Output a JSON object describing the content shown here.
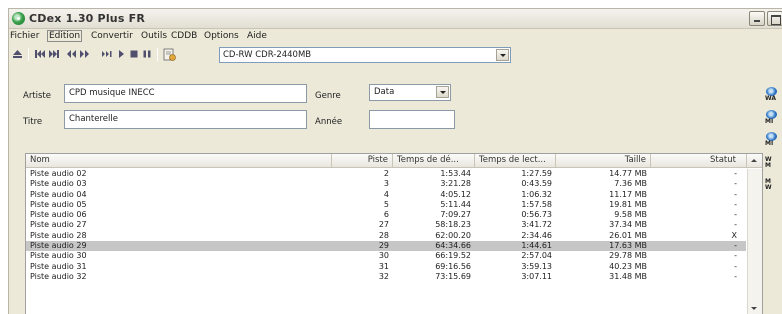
{
  "window": {
    "title": "CDex 1.30 Plus FR"
  },
  "menu": [
    "Fichier",
    "Edition",
    "Convertir",
    "Outils",
    "CDDB",
    "Options",
    "Aide"
  ],
  "toolbar": {
    "icons": [
      "eject-icon",
      "first-track-icon",
      "last-track-icon",
      "rewind-icon",
      "fast-forward-icon",
      "next-track-icon",
      "play-icon",
      "stop-icon",
      "pause-icon",
      "cddb-icon"
    ],
    "drive": "CD-RW  CDR-2440MB"
  },
  "info": {
    "artist_label": "Artiste",
    "artist_value": "CPD musique INECC",
    "title_label": "Titre",
    "title_value": "Chanterelle",
    "genre_label": "Genre",
    "genre_value": "Data",
    "year_label": "Année",
    "year_value": ""
  },
  "table": {
    "columns": [
      "Nom",
      "Piste",
      "Temps de dé...",
      "Temps de lect...",
      "Taille",
      "Statut"
    ],
    "rows": [
      [
        "Piste audio 02",
        "2",
        "1:53.44",
        "1:27.59",
        "14.77 MB",
        "-"
      ],
      [
        "Piste audio 03",
        "3",
        "3:21.28",
        "0:43.59",
        "7.36 MB",
        "-"
      ],
      [
        "Piste audio 04",
        "4",
        "4:05.12",
        "1:06.32",
        "11.17 MB",
        "-"
      ],
      [
        "Piste audio 05",
        "5",
        "5:11.44",
        "1:57.58",
        "19.81 MB",
        "-"
      ],
      [
        "Piste audio 06",
        "6",
        "7:09.27",
        "0:56.73",
        "9.58 MB",
        "-"
      ],
      [
        "Piste audio 27",
        "27",
        "58:18.23",
        "3:41.72",
        "37.34 MB",
        "-"
      ],
      [
        "Piste audio 28",
        "28",
        "62:00.20",
        "2:34.46",
        "26.01 MB",
        "X"
      ],
      [
        "Piste audio 29",
        "29",
        "64:34.66",
        "1:44.61",
        "17.63 MB",
        "-"
      ],
      [
        "Piste audio 30",
        "30",
        "66:19.52",
        "2:57.04",
        "29.78 MB",
        "-"
      ],
      [
        "Piste audio 31",
        "31",
        "69:16.56",
        "3:59.13",
        "40.23 MB",
        "-"
      ],
      [
        "Piste audio 32",
        "32",
        "73:15.69",
        "3:07.11",
        "31.48 MB",
        "-"
      ]
    ],
    "selected_index": 7
  },
  "side_icons": [
    {
      "name": "wav-to-mp3-icon",
      "abbr": "WA"
    },
    {
      "name": "mp3-to-wav-icon",
      "abbr": "MI"
    },
    {
      "name": "midi-icon",
      "abbr": "MI"
    },
    {
      "name": "wav-mp3-icon",
      "abbr": "W\nM"
    },
    {
      "name": "mp3-wav-icon",
      "abbr": "M\nW"
    }
  ]
}
